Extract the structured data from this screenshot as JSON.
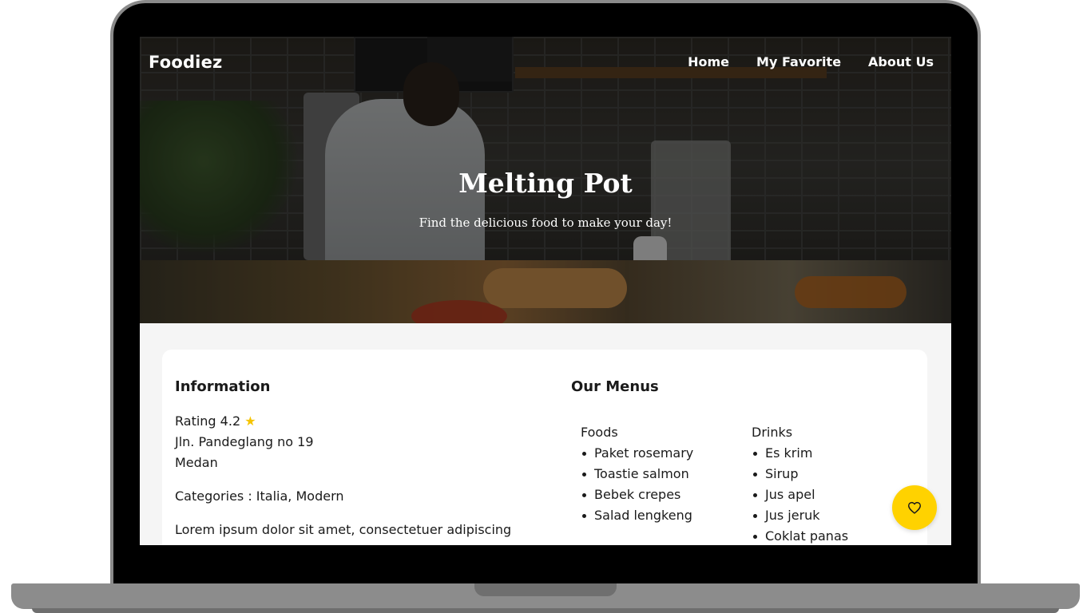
{
  "brand": {
    "name": "Foodiez"
  },
  "nav": {
    "home": "Home",
    "favorite": "My Favorite",
    "about": "About Us"
  },
  "hero": {
    "title": "Melting Pot",
    "subtitle": "Find the delicious food to make your day!"
  },
  "information": {
    "title": "Information",
    "rating_label": "Rating 4.2",
    "rating_value": 4.2,
    "address": "Jln. Pandeglang no 19",
    "city": "Medan",
    "categories": "Categories : Italia, Modern",
    "description": "Lorem ipsum dolor sit amet, consectetuer adipiscing"
  },
  "menus": {
    "title": "Our Menus",
    "foods": {
      "label": "Foods",
      "items": [
        "Paket rosemary",
        "Toastie salmon",
        "Bebek crepes",
        "Salad lengkeng"
      ]
    },
    "drinks": {
      "label": "Drinks",
      "items": [
        "Es krim",
        "Sirup",
        "Jus apel",
        "Jus jeruk",
        "Coklat panas"
      ]
    }
  },
  "colors": {
    "accent": "#ffd200",
    "star": "#f5c400",
    "text": "#1a1a1a",
    "frame": "#000000"
  },
  "icons": {
    "rating": "star-icon",
    "favorite": "heart-outline-icon"
  }
}
